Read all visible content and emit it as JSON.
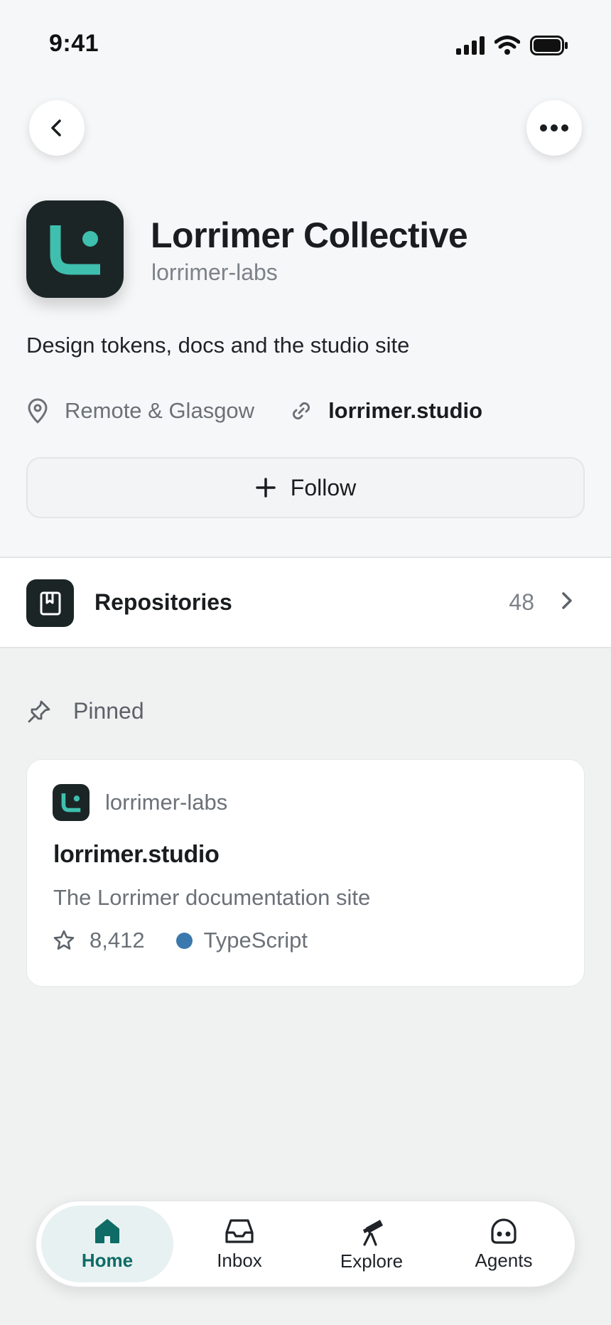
{
  "status_bar": {
    "time": "9:41"
  },
  "profile": {
    "name": "Lorrimer Collective",
    "handle": "lorrimer-labs",
    "bio": "Design tokens, docs and the studio site",
    "location": "Remote & Glasgow",
    "website": "lorrimer.studio",
    "follow_label": "Follow",
    "accent_color": "#3fbfae"
  },
  "repositories": {
    "label": "Repositories",
    "count": "48"
  },
  "pinned": {
    "header": "Pinned",
    "card": {
      "owner": "lorrimer-labs",
      "title": "lorrimer.studio",
      "description": "The Lorrimer documentation site",
      "stars": "8,412",
      "language": "TypeScript",
      "language_color": "#3b78ad"
    }
  },
  "tab_bar": {
    "tabs": [
      {
        "label": "Home",
        "icon": "home-icon",
        "active": true
      },
      {
        "label": "Inbox",
        "icon": "inbox-icon",
        "active": false
      },
      {
        "label": "Explore",
        "icon": "telescope-icon",
        "active": false
      },
      {
        "label": "Agents",
        "icon": "agent-icon",
        "active": false
      }
    ],
    "active_color": "#0f6b66"
  }
}
